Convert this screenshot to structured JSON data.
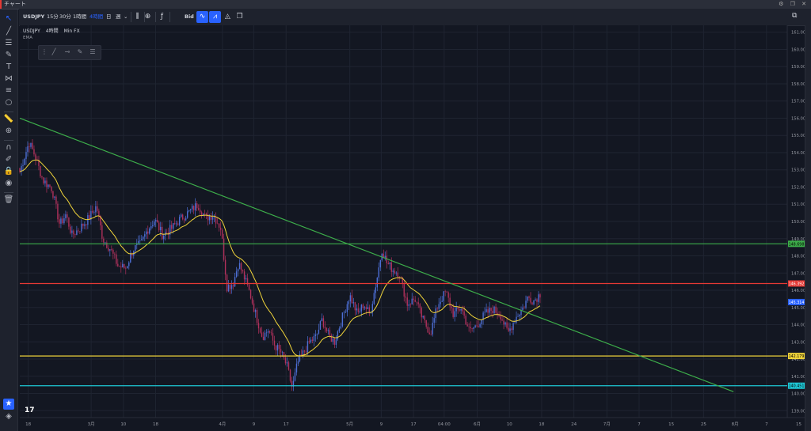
{
  "window": {
    "title": "チャート",
    "controls": "⚙ ❐ ✕"
  },
  "toolbar": {
    "symbol": "USDJPY",
    "intervals": [
      "15分",
      "30分",
      "1時間",
      "4時間",
      "日",
      "週"
    ],
    "selected_interval": "4時間",
    "price_source": "Bid",
    "chevron": "⌄"
  },
  "legend": {
    "symbol": "USDJPY",
    "interval": "4時間",
    "broker": "Min FX",
    "indicator": "EMA"
  },
  "tv_logo": "17",
  "colors": {
    "background": "#131722",
    "grid": "#1f2431",
    "up_candle": "#4d6fd6",
    "down_candle": "#b0315c",
    "ema": "#f0d43a",
    "trendline": "#3dae4a",
    "accent": "#2962ff"
  },
  "chart_data": {
    "type": "candlestick",
    "symbol": "USDJPY",
    "interval": "4時間",
    "y_axis": {
      "min": 138.6,
      "max": 161.4,
      "ticks": [
        139.0,
        140.0,
        141.0,
        142.0,
        143.0,
        144.0,
        145.0,
        146.0,
        147.0,
        148.0,
        149.0,
        150.0,
        151.0,
        152.0,
        153.0,
        154.0,
        155.0,
        156.0,
        157.0,
        158.0,
        159.0,
        160.0,
        161.0
      ],
      "tick_labels": [
        "139.000",
        "140.000",
        "141.000",
        "142.000",
        "143.000",
        "144.000",
        "145.000",
        "146.000",
        "147.000",
        "148.000",
        "149.000",
        "150.000",
        "151.000",
        "152.000",
        "153.000",
        "154.000",
        "155.000",
        "156.000",
        "157.000",
        "158.000",
        "159.000",
        "160.000",
        "161.000"
      ]
    },
    "x_axis": {
      "labels": [
        {
          "label": "18",
          "pos": 0.011
        },
        {
          "label": "3月",
          "pos": 0.093
        },
        {
          "label": "10",
          "pos": 0.135
        },
        {
          "label": "18",
          "pos": 0.177
        },
        {
          "label": "4月",
          "pos": 0.264
        },
        {
          "label": "9",
          "pos": 0.305
        },
        {
          "label": "17",
          "pos": 0.347
        },
        {
          "label": "5月",
          "pos": 0.43
        },
        {
          "label": "9",
          "pos": 0.471
        },
        {
          "label": "17",
          "pos": 0.513
        },
        {
          "label": "04:00",
          "pos": 0.553
        },
        {
          "label": "6月",
          "pos": 0.596
        },
        {
          "label": "10",
          "pos": 0.638
        },
        {
          "label": "18",
          "pos": 0.68
        },
        {
          "label": "24",
          "pos": 0.722
        },
        {
          "label": "7月",
          "pos": 0.765
        },
        {
          "label": "7",
          "pos": 0.807
        },
        {
          "label": "15",
          "pos": 0.849
        },
        {
          "label": "25",
          "pos": 0.891
        },
        {
          "label": "8月",
          "pos": 0.932
        },
        {
          "label": "7",
          "pos": 0.973
        },
        {
          "label": "15",
          "pos": 1.015
        }
      ]
    },
    "price_path": [
      [
        0.0,
        152.9
      ],
      [
        0.012,
        154.6
      ],
      [
        0.02,
        153.8
      ],
      [
        0.03,
        152.4
      ],
      [
        0.042,
        151.9
      ],
      [
        0.052,
        149.8
      ],
      [
        0.06,
        150.4
      ],
      [
        0.068,
        149.2
      ],
      [
        0.078,
        149.6
      ],
      [
        0.09,
        150.2
      ],
      [
        0.1,
        150.9
      ],
      [
        0.108,
        149.0
      ],
      [
        0.118,
        148.4
      ],
      [
        0.128,
        147.4
      ],
      [
        0.138,
        147.3
      ],
      [
        0.148,
        148.4
      ],
      [
        0.158,
        148.7
      ],
      [
        0.166,
        149.5
      ],
      [
        0.176,
        150.1
      ],
      [
        0.186,
        149.2
      ],
      [
        0.198,
        149.6
      ],
      [
        0.208,
        150.1
      ],
      [
        0.222,
        150.6
      ],
      [
        0.232,
        151.0
      ],
      [
        0.242,
        150.2
      ],
      [
        0.252,
        150.4
      ],
      [
        0.262,
        149.6
      ],
      [
        0.27,
        146.2
      ],
      [
        0.278,
        146.4
      ],
      [
        0.285,
        147.6
      ],
      [
        0.292,
        146.8
      ],
      [
        0.3,
        145.8
      ],
      [
        0.306,
        144.8
      ],
      [
        0.316,
        143.3
      ],
      [
        0.324,
        143.7
      ],
      [
        0.332,
        142.8
      ],
      [
        0.34,
        142.4
      ],
      [
        0.348,
        141.6
      ],
      [
        0.355,
        140.3
      ],
      [
        0.362,
        141.8
      ],
      [
        0.37,
        142.4
      ],
      [
        0.378,
        143.0
      ],
      [
        0.386,
        143.3
      ],
      [
        0.394,
        144.3
      ],
      [
        0.402,
        143.4
      ],
      [
        0.41,
        143.0
      ],
      [
        0.42,
        144.4
      ],
      [
        0.43,
        145.7
      ],
      [
        0.44,
        144.6
      ],
      [
        0.448,
        145.2
      ],
      [
        0.456,
        144.6
      ],
      [
        0.465,
        146.6
      ],
      [
        0.472,
        148.4
      ],
      [
        0.478,
        147.6
      ],
      [
        0.486,
        147.2
      ],
      [
        0.494,
        147.0
      ],
      [
        0.505,
        145.2
      ],
      [
        0.515,
        145.5
      ],
      [
        0.525,
        144.3
      ],
      [
        0.535,
        143.5
      ],
      [
        0.545,
        145.2
      ],
      [
        0.555,
        145.9
      ],
      [
        0.565,
        144.6
      ],
      [
        0.575,
        145.0
      ],
      [
        0.586,
        143.6
      ],
      [
        0.596,
        144.0
      ],
      [
        0.606,
        144.6
      ],
      [
        0.616,
        144.9
      ],
      [
        0.626,
        144.6
      ],
      [
        0.636,
        143.5
      ],
      [
        0.646,
        144.4
      ],
      [
        0.656,
        145.0
      ],
      [
        0.662,
        145.6
      ],
      [
        0.67,
        145.4
      ],
      [
        0.678,
        145.8
      ]
    ],
    "horizontal_lines": [
      {
        "value": 148.698,
        "label": "148.698",
        "color": "#3dae4a"
      },
      {
        "value": 146.392,
        "label": "146.392",
        "color": "#e53935"
      },
      {
        "value": 145.314,
        "label": "145.314",
        "color": "#2962ff"
      },
      {
        "value": 142.179,
        "label": "142.179",
        "color": "#f0d43a"
      },
      {
        "value": 140.451,
        "label": "140.451",
        "color": "#1ec8d6"
      }
    ],
    "trendline": {
      "from": [
        0.0,
        156.0
      ],
      "to": [
        0.93,
        140.1
      ],
      "color": "#3dae4a"
    },
    "indicator": {
      "name": "EMA",
      "color": "#f0d43a"
    }
  }
}
